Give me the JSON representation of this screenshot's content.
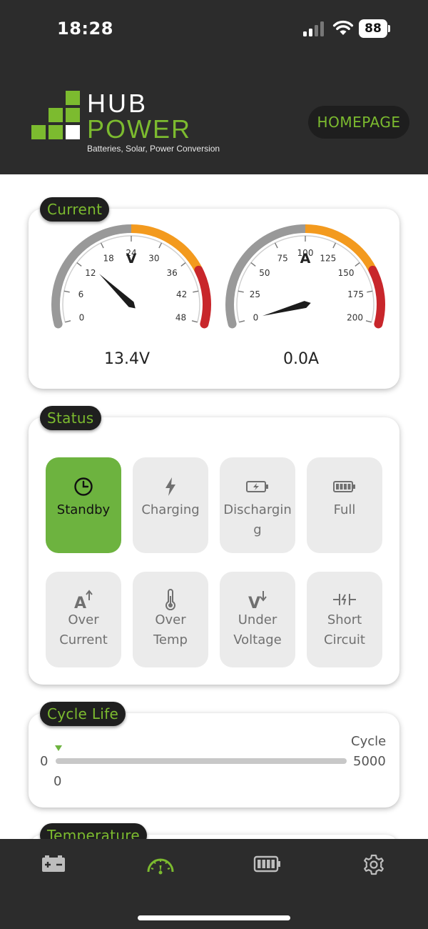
{
  "status_bar": {
    "time": "18:28",
    "battery_level": "88"
  },
  "header": {
    "logo": {
      "line1": "HUB",
      "line2": "POWER",
      "tagline": "Batteries, Solar, Power Conversion"
    },
    "homepage_button": "HOMEPAGE"
  },
  "current": {
    "section_title": "Current",
    "voltage_gauge": {
      "unit": "V",
      "ticks": [
        "0",
        "6",
        "12",
        "18",
        "24",
        "30",
        "36",
        "42",
        "48"
      ],
      "reading": "13.4V",
      "value": 13.4,
      "max": 48
    },
    "amp_gauge": {
      "unit": "A",
      "ticks": [
        "0",
        "25",
        "50",
        "75",
        "100",
        "125",
        "150",
        "175",
        "200"
      ],
      "reading": "0.0A",
      "value": 0,
      "max": 200
    },
    "colors": {
      "normal": "#999999",
      "warning": "#f39a1e",
      "danger": "#c8262b"
    }
  },
  "status": {
    "section_title": "Status",
    "tiles": [
      {
        "label": "Standby",
        "icon": "clock-icon",
        "active": true
      },
      {
        "label": "Charging",
        "icon": "lightning-icon",
        "active": false
      },
      {
        "label": "Discharging",
        "icon": "battery-discharging-icon",
        "active": false
      },
      {
        "label": "Full",
        "icon": "battery-full-icon",
        "active": false
      },
      {
        "label": "Over Current",
        "icon": "over-current-icon",
        "active": false
      },
      {
        "label": "Over Temp",
        "icon": "thermometer-icon",
        "active": false
      },
      {
        "label": "Under Voltage",
        "icon": "under-voltage-icon",
        "active": false
      },
      {
        "label": "Short Circuit",
        "icon": "short-circuit-icon",
        "active": false
      }
    ],
    "active_color": "#6db33f"
  },
  "cycle_life": {
    "section_title": "Cycle Life",
    "unit_label": "Cycle",
    "min_label": "0",
    "max_label": "5000",
    "current_value": "0"
  },
  "temperature": {
    "section_title": "Temperature"
  },
  "bottom_nav": {
    "items": [
      {
        "icon": "battery-terminal-icon",
        "active": false
      },
      {
        "icon": "gauge-icon",
        "active": true
      },
      {
        "icon": "battery-icon",
        "active": false
      },
      {
        "icon": "settings-icon",
        "active": false
      }
    ]
  },
  "brand_colors": {
    "green": "#7cbb2f",
    "dark": "#2c2c2c"
  }
}
